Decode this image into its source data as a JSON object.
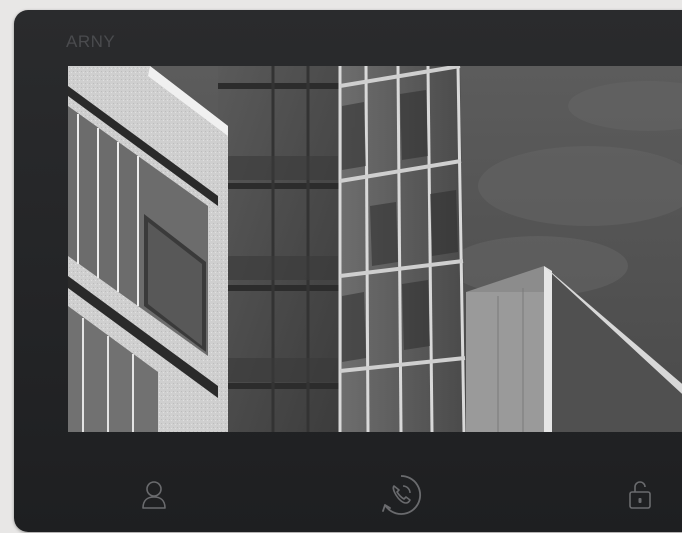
{
  "device": {
    "brand": "ARNY"
  },
  "controls": {
    "items": [
      {
        "icon": "person-icon"
      },
      {
        "icon": "phone-call-icon"
      },
      {
        "icon": "unlock-icon"
      }
    ],
    "icon_color": "#6a6b6e"
  },
  "screen": {
    "content": "camera-view"
  },
  "colors": {
    "bezel": "#252628",
    "background": "#e8e7e6",
    "brand_text": "#4a4b4e"
  }
}
